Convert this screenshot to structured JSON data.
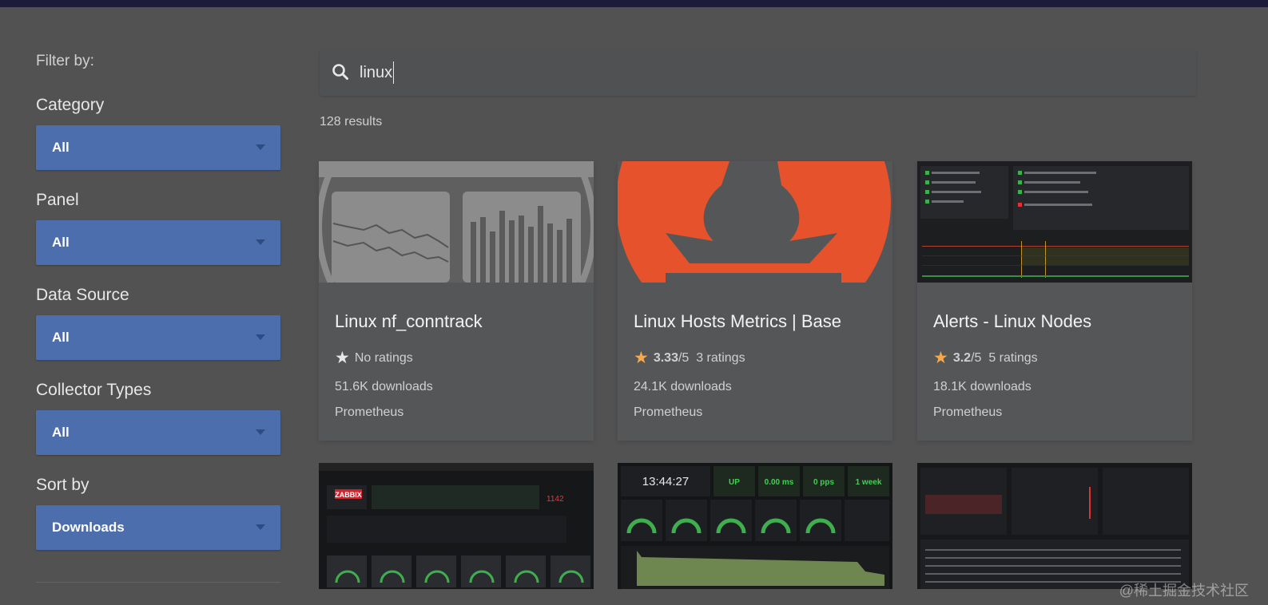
{
  "sidebar": {
    "filter_label": "Filter by:",
    "groups": [
      {
        "label": "Category",
        "value": "All"
      },
      {
        "label": "Panel",
        "value": "All"
      },
      {
        "label": "Data Source",
        "value": "All"
      },
      {
        "label": "Collector Types",
        "value": "All"
      },
      {
        "label": "Sort by",
        "value": "Downloads"
      }
    ]
  },
  "search": {
    "query": "linux"
  },
  "results_count": "128 results",
  "cards": [
    {
      "title": "Linux nf_conntrack",
      "rating_score": "",
      "rating_suffix": "",
      "rating_text": "No ratings",
      "downloads": "51.6K downloads",
      "source": "Prometheus"
    },
    {
      "title": "Linux Hosts Metrics | Base",
      "rating_score": "3.33",
      "rating_suffix": "/5",
      "rating_text": "3 ratings",
      "downloads": "24.1K downloads",
      "source": "Prometheus"
    },
    {
      "title": "Alerts - Linux Nodes",
      "rating_score": "3.2",
      "rating_suffix": "/5",
      "rating_text": "5 ratings",
      "downloads": "18.1K downloads",
      "source": "Prometheus"
    }
  ],
  "thumbnails": {
    "zabbix_logo": "ZABBIX",
    "clock": "13:44:27",
    "stats": [
      "UP",
      "0.00 ms",
      "0 pps",
      "1 week"
    ],
    "zabbix_stat": "1142"
  },
  "watermark": "@稀土掘金技术社区",
  "colors": {
    "select_bg": "#4c6ead",
    "star_filled": "#f5a94c",
    "star_empty": "#e6e7e8",
    "grafana_orange": "#e5522b"
  },
  "icons": {
    "search": "search-icon",
    "caret": "caret-down-icon",
    "star": "star-icon"
  }
}
